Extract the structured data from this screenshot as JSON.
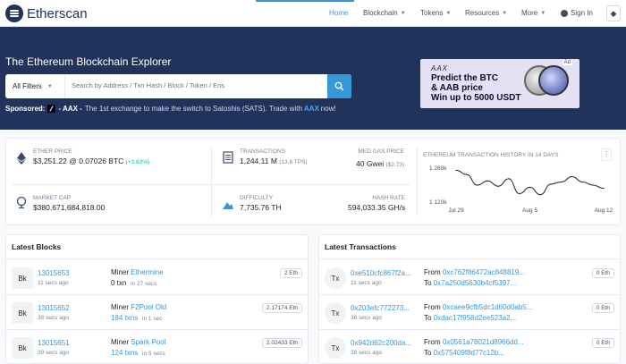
{
  "header": {
    "logo_text": "Etherscan",
    "nav": [
      {
        "label": "Home",
        "active": true
      },
      {
        "label": "Blockchain"
      },
      {
        "label": "Tokens"
      },
      {
        "label": "Resources"
      },
      {
        "label": "More"
      }
    ],
    "sign_in": "Sign In",
    "network_symbol": "◆"
  },
  "hero": {
    "title": "The Ethereum Blockchain Explorer",
    "filter_label": "All Filters",
    "search_placeholder": "Search by Address / Txn Hash / Block / Token / Ens",
    "sponsored_label": "Sponsored:",
    "sponsor_name": "- AAX -",
    "sponsor_text": "The 1st exchange to make the switch to Satoshis (SATS). Trade with",
    "sponsor_link": "AAX",
    "sponsor_end": "now!"
  },
  "ad": {
    "badge": "Ad",
    "brand": "AAX",
    "line1": "Predict the BTC",
    "line2": "& AAB price",
    "line3": "Win up to 5000 USDT"
  },
  "stats": {
    "ether_price": {
      "label": "Ether Price",
      "value": "$3,251.22",
      "btc": "@ 0.07026 BTC",
      "change": "(+3.83%)"
    },
    "market_cap": {
      "label": "Market Cap",
      "value": "$380,671,684,818.00"
    },
    "transactions": {
      "label": "Transactions",
      "value": "1,244.11 M",
      "tps": "(13.6 TPS)"
    },
    "med_gas": {
      "label": "Med Gas Price",
      "value": "40 Gwei",
      "usd": "($2.73)"
    },
    "difficulty": {
      "label": "Difficulty",
      "value": "7,735.76 TH"
    },
    "hash_rate": {
      "label": "Hash Rate",
      "value": "594,033.35 GH/s"
    }
  },
  "chart_data": {
    "type": "line",
    "title": "Ethereum Transaction History in 14 Days",
    "y_tick_labels": [
      "1 280k",
      "1 120k"
    ],
    "x_tick_labels": [
      "Jul 29",
      "Aug 5",
      "Aug 12"
    ],
    "ylim": [
      1120000,
      1280000
    ],
    "x": [
      "Jul 29",
      "Jul 30",
      "Jul 31",
      "Aug 1",
      "Aug 2",
      "Aug 3",
      "Aug 4",
      "Aug 5",
      "Aug 6",
      "Aug 7",
      "Aug 8",
      "Aug 9",
      "Aug 10",
      "Aug 11",
      "Aug 12"
    ],
    "series": [
      {
        "values": [
          1270000,
          1250000,
          1200000,
          1220000,
          1195000,
          1230000,
          1160000,
          1190000,
          1155000,
          1205000,
          1215000,
          1240000,
          1215000,
          1200000,
          1185000
        ]
      }
    ]
  },
  "latest_blocks": {
    "title": "Latest Blocks",
    "badge": "Bk",
    "items": [
      {
        "number": "13015653",
        "time": "11 secs ago",
        "miner_label": "Miner",
        "miner": "Ethermine",
        "txns": "0 txn",
        "txns_time": "in 27 secs",
        "reward": "2 Eth",
        "txns_is_link": false
      },
      {
        "number": "13015652",
        "time": "38 secs ago",
        "miner_label": "Miner",
        "miner": "F2Pool Old",
        "txns": "184 txns",
        "txns_time": "in 1 sec",
        "reward": "2.17174 Eth",
        "txns_is_link": true
      },
      {
        "number": "13015651",
        "time": "39 secs ago",
        "miner_label": "Miner",
        "miner": "Spark Pool",
        "txns": "124 txns",
        "txns_time": "in 5 secs",
        "reward": "2.02433 Eth",
        "txns_is_link": true
      }
    ]
  },
  "latest_transactions": {
    "title": "Latest Transactions",
    "badge": "Tx",
    "items": [
      {
        "hash": "0xe510cfc867f2a...",
        "time": "11 secs ago",
        "from_label": "From",
        "from": "0xc762f86472ac848819...",
        "to_label": "To",
        "to": "0x7a250d5630b4cf5397...",
        "value": "0 Eth"
      },
      {
        "hash": "0x203efc772273...",
        "time": "38 secs ago",
        "from_label": "From",
        "from": "0xcaee9cfb5dc1d60d0ab5...",
        "to_label": "To",
        "to": "0xdac17f958d2ee523a2...",
        "value": "0 Eth"
      },
      {
        "hash": "0x942d62c200da...",
        "time": "38 secs ago",
        "from_label": "From",
        "from": "0x0561a78021d8966dd...",
        "to_label": "To",
        "to": "0x575409f8d77c12b...",
        "value": "0 Eth"
      }
    ]
  }
}
